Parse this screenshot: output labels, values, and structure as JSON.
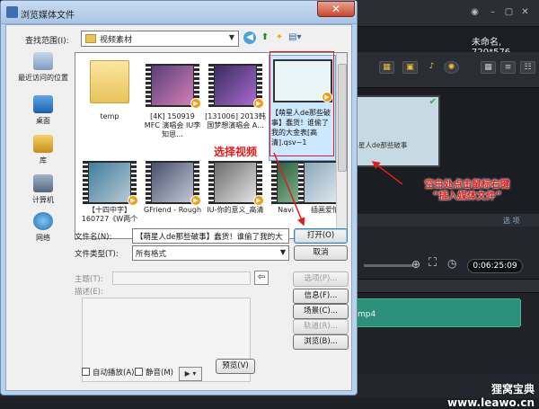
{
  "app": {
    "project_info": "未命名, 720*576",
    "timecode": "0:06:25:09",
    "tab_label": "选 项",
    "media_thumb_text": "星人de那些破事",
    "clip_label": "mp4",
    "colors": {
      "accent": "#2c8f7a",
      "annotation": "#e31b1b",
      "dialog_frame": "#b9d1ea"
    }
  },
  "dialog": {
    "title": "浏览媒体文件",
    "close_icon": "close-icon",
    "look_in_label": "查找范围(I):",
    "look_in_value": "视频素材",
    "places": [
      {
        "label": "最近访问的位置",
        "icon": "recent-icon"
      },
      {
        "label": "桌面",
        "icon": "desktop-icon"
      },
      {
        "label": "库",
        "icon": "library-icon"
      },
      {
        "label": "计算机",
        "icon": "computer-icon"
      },
      {
        "label": "网络",
        "icon": "network-icon"
      }
    ],
    "files": [
      {
        "name": "temp",
        "type": "folder"
      },
      {
        "name": "[4K] 150919 MFC 演唱会 IU李知恩...",
        "type": "video"
      },
      {
        "name": "[131006] 2013韩国梦想演唱会 A...",
        "type": "video"
      },
      {
        "name": "【萌星人de那些破事】蠢货！谁偷了我的大金表[高清].qsv~1",
        "type": "video",
        "selected": true
      },
      {
        "name": "【十四中字】160727《W两个",
        "type": "video"
      },
      {
        "name": "GFriend - Rough",
        "type": "video"
      },
      {
        "name": "IU-你的意义_高清",
        "type": "video"
      },
      {
        "name": "Navi",
        "type": "video"
      },
      {
        "name": "插画爱情",
        "type": "video"
      }
    ],
    "file_name_label": "文件名(N):",
    "file_name_value": "【萌星人de那些破事】蠢货！谁偷了我的大",
    "file_type_label": "文件类型(T):",
    "file_type_value": "所有格式",
    "open_button": "打开(O)",
    "cancel_button": "取消",
    "subject_label": "主题(T):",
    "description_label": "描述(E):",
    "options_button": "选项(P)...",
    "info_button": "信息(F)...",
    "scene_button": "场景(C)...",
    "track_button": "轨道(R)...",
    "browse_button": "浏览(B)...",
    "autoplay_label": "自动播放(A)",
    "mute_label": "静音(M)",
    "preview_button": "预览(V)"
  },
  "annotations": {
    "select_video": "选择视频",
    "right_click_line1": "空白处点击鼠标右键",
    "right_click_line2": "“插入媒体文件”"
  },
  "watermark": "狸窝宝典 www.leawo.cn"
}
